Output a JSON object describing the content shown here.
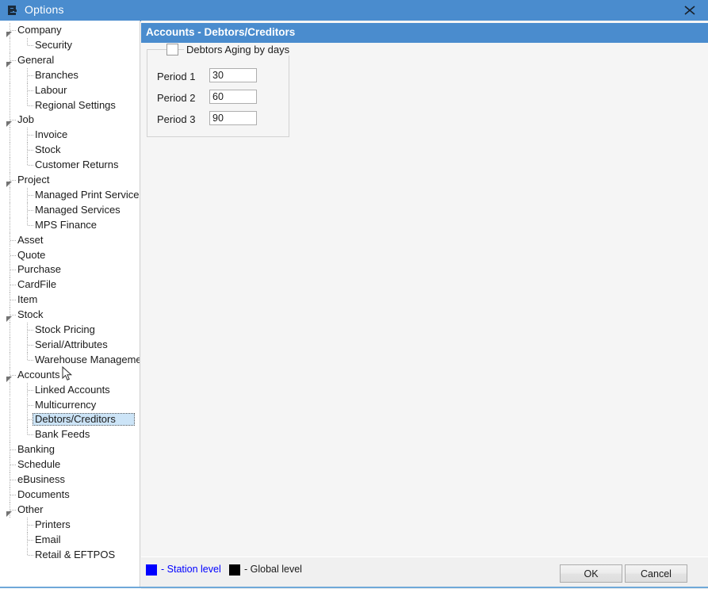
{
  "window": {
    "title": "Options",
    "icon": "options-window-icon",
    "close_icon": "close-icon",
    "titlebar_color": "#4a8cce"
  },
  "sidebar": {
    "name": "options-category-tree",
    "selected": "Debtors/Creditors",
    "items": [
      {
        "label": "Company",
        "level": 0,
        "expanded": true
      },
      {
        "label": "Security",
        "level": 1
      },
      {
        "label": "General",
        "level": 0,
        "expanded": true
      },
      {
        "label": "Branches",
        "level": 1
      },
      {
        "label": "Labour",
        "level": 1
      },
      {
        "label": "Regional Settings",
        "level": 1
      },
      {
        "label": "Job",
        "level": 0,
        "expanded": true
      },
      {
        "label": "Invoice",
        "level": 1
      },
      {
        "label": "Stock",
        "level": 1
      },
      {
        "label": "Customer Returns",
        "level": 1
      },
      {
        "label": "Project",
        "level": 0,
        "expanded": true
      },
      {
        "label": "Managed Print Services",
        "level": 1
      },
      {
        "label": "Managed Services",
        "level": 1
      },
      {
        "label": "MPS Finance",
        "level": 1
      },
      {
        "label": "Asset",
        "level": 0
      },
      {
        "label": "Quote",
        "level": 0
      },
      {
        "label": "Purchase",
        "level": 0
      },
      {
        "label": "CardFile",
        "level": 0
      },
      {
        "label": "Item",
        "level": 0
      },
      {
        "label": "Stock",
        "level": 0,
        "expanded": true
      },
      {
        "label": "Stock Pricing",
        "level": 1
      },
      {
        "label": "Serial/Attributes",
        "level": 1
      },
      {
        "label": "Warehouse Management",
        "level": 1
      },
      {
        "label": "Accounts",
        "level": 0,
        "expanded": true
      },
      {
        "label": "Linked Accounts",
        "level": 1
      },
      {
        "label": "Multicurrency",
        "level": 1
      },
      {
        "label": "Debtors/Creditors",
        "level": 1,
        "selected": true
      },
      {
        "label": "Bank Feeds",
        "level": 1
      },
      {
        "label": "Banking",
        "level": 0
      },
      {
        "label": "Schedule",
        "level": 0
      },
      {
        "label": "eBusiness",
        "level": 0
      },
      {
        "label": "Documents",
        "level": 0
      },
      {
        "label": "Other",
        "level": 0,
        "expanded": true
      },
      {
        "label": "Printers",
        "level": 1
      },
      {
        "label": "Email",
        "level": 1
      },
      {
        "label": "Retail & EFTPOS",
        "level": 1
      }
    ]
  },
  "main": {
    "section_title": "Accounts - Debtors/Creditors",
    "aging_group": {
      "checkbox_label": "Debtors Aging by days",
      "checked": false,
      "periods": [
        {
          "label": "Period 1",
          "value": "30"
        },
        {
          "label": "Period 2",
          "value": "60"
        },
        {
          "label": "Period 3",
          "value": "90"
        }
      ]
    }
  },
  "footer": {
    "legend": [
      {
        "color": "#0000ff",
        "text": "- Station level",
        "text_color": "#0000ff"
      },
      {
        "color": "#000000",
        "text": "- Global level",
        "text_color": "#1b1b1b"
      }
    ],
    "ok_label": "OK",
    "cancel_label": "Cancel"
  }
}
